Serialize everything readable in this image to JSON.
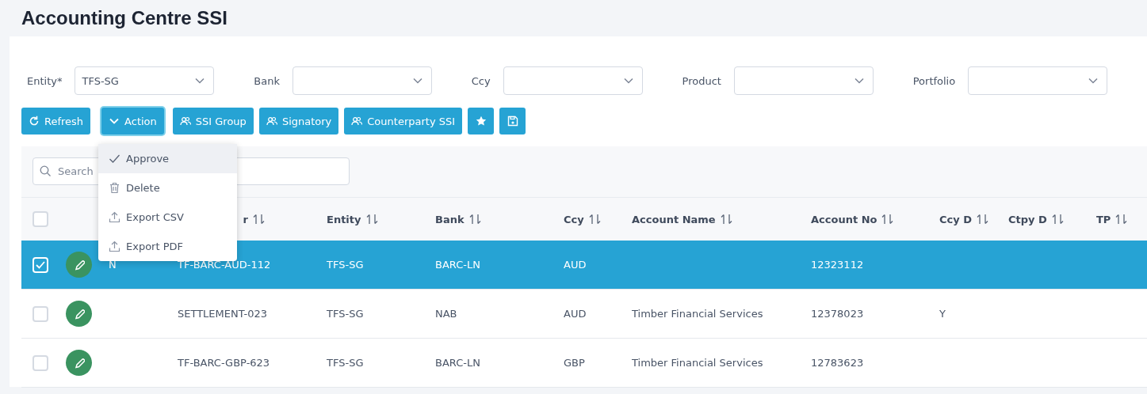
{
  "page_title": "Accounting Centre SSI",
  "filters": [
    {
      "label": "Entity*",
      "value": "TFS-SG"
    },
    {
      "label": "Bank"
    },
    {
      "label": "Ccy"
    },
    {
      "label": "Product"
    },
    {
      "label": "Portfolio"
    }
  ],
  "buttons": [
    {
      "kind": "refresh",
      "label": "Refresh",
      "expanded": false
    },
    {
      "kind": "dropdown",
      "label": "Action",
      "expanded": true
    },
    {
      "kind": "people",
      "label": "SSI Group",
      "expanded": false
    },
    {
      "kind": "people",
      "label": "Signatory",
      "expanded": false
    },
    {
      "kind": "people",
      "label": "Counterparty SSI",
      "expanded": false
    },
    {
      "kind": "star",
      "expanded": false
    },
    {
      "kind": "save",
      "expanded": false
    }
  ],
  "action_menu": [
    {
      "kind": "check",
      "label": "Approve",
      "selected": true
    },
    {
      "kind": "trash",
      "label": "Delete",
      "selected": false
    },
    {
      "kind": "upload",
      "label": "Export CSV",
      "selected": false
    },
    {
      "kind": "upload",
      "label": "Export PDF",
      "selected": false
    }
  ],
  "search": {
    "placeholder": "Search"
  },
  "table": {
    "header_checked": false,
    "columns": [
      {
        "label": "r"
      },
      {
        "label": "Entity"
      },
      {
        "label": "Bank"
      },
      {
        "label": "Ccy"
      },
      {
        "label": "Account Name"
      },
      {
        "label": "Account No"
      },
      {
        "label": "Ccy D"
      },
      {
        "label": "Ctpy D"
      },
      {
        "label": "TP"
      }
    ],
    "rows": [
      {
        "selected": true,
        "checked": true,
        "column_2": "N",
        "column_3": "TF-BARC-AUD-112",
        "entity": "TFS-SG",
        "bank": "BARC-LN",
        "ccy": "AUD",
        "account_no": "12323112"
      },
      {
        "selected": false,
        "checked": false,
        "column_3": "SETTLEMENT-023",
        "entity": "TFS-SG",
        "bank": "NAB",
        "ccy": "AUD",
        "account_name": "Timber Financial Services",
        "account_no": "12378023",
        "ccy_d": "Y"
      },
      {
        "selected": false,
        "checked": false,
        "column_3": "TF-BARC-GBP-623",
        "entity": "TFS-SG",
        "bank": "BARC-LN",
        "ccy": "GBP",
        "account_name": "Timber Financial Services",
        "account_no": "12783623"
      }
    ]
  }
}
